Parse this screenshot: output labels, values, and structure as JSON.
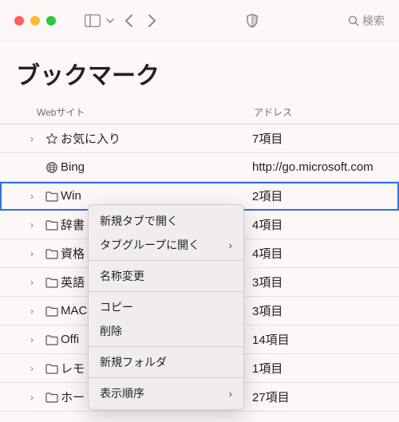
{
  "window": {
    "search_placeholder": "検索"
  },
  "page": {
    "title": "ブックマーク"
  },
  "columns": {
    "site": "Webサイト",
    "address": "アドレス"
  },
  "rows": [
    {
      "disclosure": true,
      "icon": "star",
      "label": "お気に入り",
      "address": "7項目",
      "selected": false
    },
    {
      "disclosure": false,
      "icon": "globe",
      "label": "Bing",
      "address": "http://go.microsoft.com",
      "selected": false
    },
    {
      "disclosure": true,
      "icon": "folder",
      "label": "Win",
      "address": "2項目",
      "selected": true
    },
    {
      "disclosure": true,
      "icon": "folder",
      "label": "辞書",
      "address": "4項目",
      "selected": false
    },
    {
      "disclosure": true,
      "icon": "folder",
      "label": "資格",
      "address": "4項目",
      "selected": false
    },
    {
      "disclosure": true,
      "icon": "folder",
      "label": "英語",
      "address": "3項目",
      "selected": false
    },
    {
      "disclosure": true,
      "icon": "folder",
      "label": "MAC",
      "address": "3項目",
      "selected": false
    },
    {
      "disclosure": true,
      "icon": "folder",
      "label": "Offi",
      "address": "14項目",
      "selected": false
    },
    {
      "disclosure": true,
      "icon": "folder",
      "label": "レモ",
      "address": "1項目",
      "selected": false
    },
    {
      "disclosure": true,
      "icon": "folder",
      "label": "ホー",
      "address": "27項目",
      "selected": false
    }
  ],
  "context_menu": {
    "open_new_tab": "新規タブで開く",
    "open_tab_group": "タブグループに開く",
    "rename": "名称変更",
    "copy": "コピー",
    "delete": "削除",
    "new_folder": "新規フォルダ",
    "sort_order": "表示順序"
  },
  "icons": {
    "disclosure": "›",
    "submenu": "›"
  }
}
